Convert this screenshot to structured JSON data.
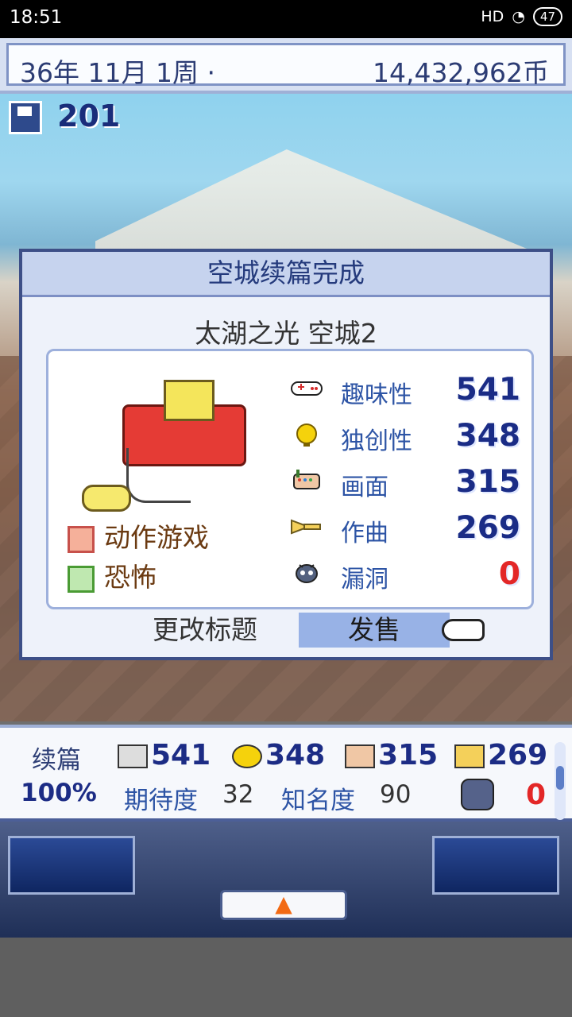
{
  "status_bar": {
    "time": "18:51",
    "signal": "HD",
    "battery": "47"
  },
  "top_bar": {
    "date": "36年 11月 1周 ·",
    "money": "14,432,962币"
  },
  "save_counter": "201",
  "dialog": {
    "title": "空城续篇完成",
    "game_title": "太湖之光 空城2",
    "genres": [
      {
        "label": "动作游戏",
        "icon": "action-genre-icon"
      },
      {
        "label": "恐怖",
        "icon": "horror-genre-icon"
      }
    ],
    "stats": [
      {
        "label": "趣味性",
        "value": "541",
        "icon": "gamepad-icon"
      },
      {
        "label": "独创性",
        "value": "348",
        "icon": "light-bulb-icon"
      },
      {
        "label": "画面",
        "value": "315",
        "icon": "paint-palette-icon"
      },
      {
        "label": "作曲",
        "value": "269",
        "icon": "trumpet-icon"
      },
      {
        "label": "漏洞",
        "value": "0",
        "icon": "bug-icon"
      }
    ],
    "buttons": {
      "change_title": "更改标题",
      "release": "发售"
    }
  },
  "bottom_info": {
    "label": "续篇",
    "progress": "100%",
    "fun": "541",
    "originality": "348",
    "graphics": "315",
    "sound": "269",
    "expectation_label": "期待度",
    "expectation_value": "32",
    "fame_label": "知名度",
    "fame_value": "90",
    "bugs": "0"
  },
  "bottom_controls": {
    "up_button": "▲"
  },
  "colors": {
    "accent_blue": "#1a2c86",
    "bug_red": "#e32727",
    "genre_brown": "#6b3a11"
  }
}
